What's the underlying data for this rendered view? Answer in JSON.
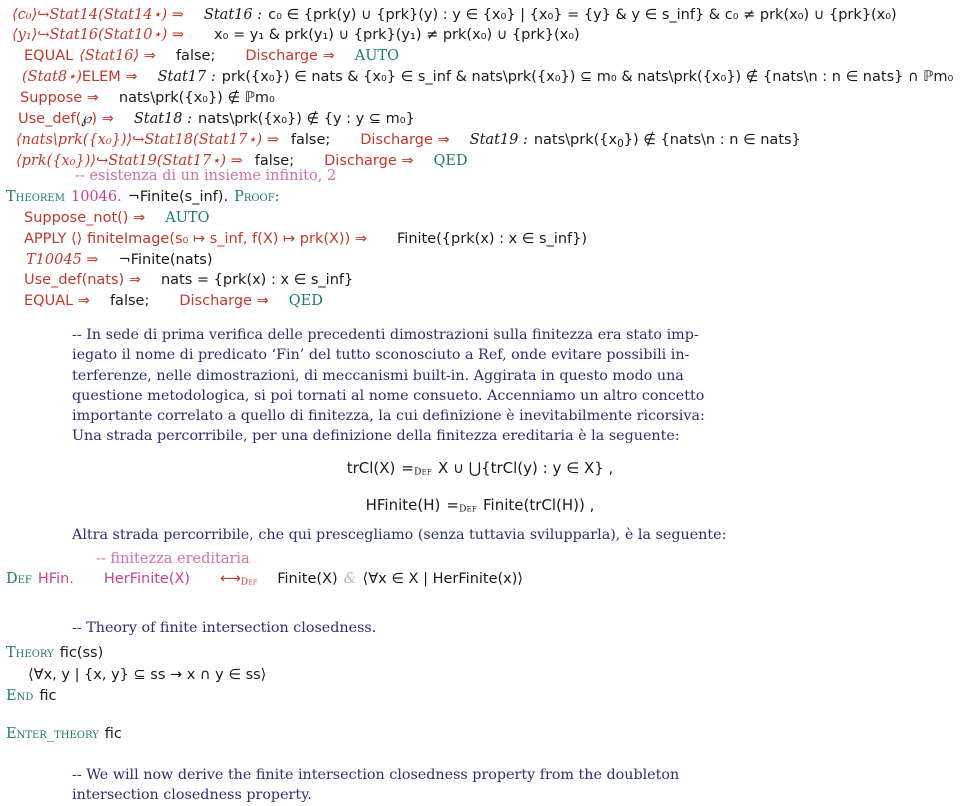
{
  "document": {
    "type": "proof-script-listing",
    "language_mix": [
      "Ref/ÆtnaNova proof script",
      "Italian commentary",
      "English commentary"
    ]
  },
  "proof_block_1": {
    "lines": [
      {
        "hint": "⟨c₀⟩↪Stat14(Stat14⋆) ⇒",
        "label": "Stat16 :",
        "body": "c₀ ∈ {prk(y) ∪ {prk}(y) : y ∈ {x₀} | {x₀} = {y} & y ∈ s_inf} & c₀ ≠ prk(x₀) ∪ {prk}(x₀)"
      },
      {
        "hint": "⟨y₁⟩↪Stat16(Stat10⋆) ⇒",
        "label": "",
        "body": "x₀ = y₁ & prk(y₁) ∪ {prk}(y₁) ≠ prk(x₀) ∪ {prk}(x₀)"
      },
      {
        "hint": "EQUAL ⟨Stat16⟩ ⇒",
        "label": "",
        "body": "false;   Discharge ⇒  AUTO"
      },
      {
        "hint": "(Stat8⋆)ELEM ⇒",
        "label": "Stat17 :",
        "body": "prk({x₀}) ∈ nats & {x₀} ∈ s_inf & nats\\prk({x₀}) ⊆ m₀ & nats\\prk({x₀}) ∉ {nats\\n : n ∈ nats} ∩ ℙm₀"
      },
      {
        "hint": "Suppose ⇒",
        "label": "",
        "body": "nats\\prk({x₀}) ∉ ℙm₀"
      },
      {
        "hint": "Use_def(ℙ) ⇒",
        "label": "Stat18 :",
        "body": "nats\\prk({x₀}) ∉ {y : y ⊆ m₀}"
      },
      {
        "hint": "⟨nats\\prk({x₀})⟩↪Stat18(Stat17⋆) ⇒",
        "label": "",
        "body": "false;   Discharge ⇒   Stat19 : nats\\prk({x₀}) ∉ {nats\\n : n ∈ nats}"
      },
      {
        "hint": "⟨prk({x₀})⟩↪Stat19(Stat17⋆) ⇒",
        "label": "",
        "body": "false;   Discharge ⇒  QED"
      }
    ],
    "keywords": {
      "equal": "EQUAL",
      "discharge": "Discharge",
      "auto": "AUTO",
      "qed": "QED",
      "suppose": "Suppose",
      "use_def": "Use_def",
      "elem": "ELEM",
      "false": "false;"
    }
  },
  "comment_esistenza": "-- esistenza di un insieme infinito, 2",
  "theorem_10046": {
    "keyword": "Theorem",
    "number": "10046.",
    "statement": "¬Finite(s_inf).",
    "proof_keyword": "Proof:",
    "lines": [
      {
        "hint": "Suppose_not() ⇒",
        "body": "AUTO"
      },
      {
        "hint": "APPLY ⟨⟩ finiteImage(s₀ ↦ s_inf, f(X) ↦ prk(X)) ⇒",
        "body": "Finite({prk(x) : x ∈ s_inf})"
      },
      {
        "hint": "T10045 ⇒",
        "body": "¬Finite(nats)"
      },
      {
        "hint": "Use_def(nats) ⇒",
        "body": "nats = {prk(x) : x ∈ s_inf}"
      },
      {
        "hint": "EQUAL ⇒",
        "body": "false;   Discharge ⇒  QED"
      }
    ]
  },
  "italian_paragraph": {
    "lines": [
      "-- In sede di prima verifica delle precedenti dimostrazioni sulla finitezza era stato imp-",
      "iegato il nome di predicato ‘Fin’ del tutto sconosciuto a Ref, onde evitare possibili in-",
      "terferenze, nelle dimostrazioni, di meccanismi built-in.   Aggirata in questo modo una",
      "questione metodologica, si  poi tornati al nome consueto.  Accenniamo un altro concetto",
      "importante correlato a quello di finitezza, la cui definizione è inevitabilmente ricorsiva:",
      "Una strada percorribile, per una definizione della finitezza ereditaria è la seguente:"
    ]
  },
  "formula_trcl": {
    "lhs": "trCl(X)",
    "eq": "=",
    "eq_sub": "Def",
    "rhs": "X ∪ ⋃{trCl(y) : y ∈ X} ,"
  },
  "formula_hfinite": {
    "lhs": "HFinite(H)",
    "eq": "=",
    "eq_sub": "Def",
    "rhs": "Finite(trCl(H)) ,"
  },
  "italian_paragraph_2": {
    "lines": [
      "Altra strada percorribile, che qui prescegliamo (senza tuttavia svilupparla), è la seguente:"
    ]
  },
  "comment_finitezza": "-- finitezza ereditaria",
  "def_hfin": {
    "keyword": "Def",
    "name": "HFin.",
    "predicate": "HerFinite(X)",
    "arrow_sub": "Def",
    "body_left": "Finite(X)",
    "amp": "&",
    "body_right": "⟨∀x ∈ X | HerFinite(x)⟩"
  },
  "comment_theory": "-- Theory of finite intersection closedness.",
  "theory_fic": {
    "keyword": "Theory",
    "name": "fic(ss)",
    "assumption": "⟨∀x, y | {x, y} ⊆ ss → x ∩ y ∈ ss⟩",
    "end_keyword": "End",
    "end_name": "fic"
  },
  "enter_theory": {
    "keyword": "Enter_theory",
    "name": "fic"
  },
  "english_paragraph": {
    "lines": [
      "-- We will now derive the finite intersection closedness property from the doubleton",
      "intersection closedness property."
    ]
  },
  "colors": {
    "keyword_red": "#c0392b",
    "smallcaps_teal": "#1f7a70",
    "number_pink": "#cf3f8f",
    "comment_pink": "#cf6fa8",
    "prose_blue": "#2b2f6b",
    "math_black": "#1a1a1a",
    "amp_gray": "#b9b9b9",
    "background": "#ffffff"
  }
}
